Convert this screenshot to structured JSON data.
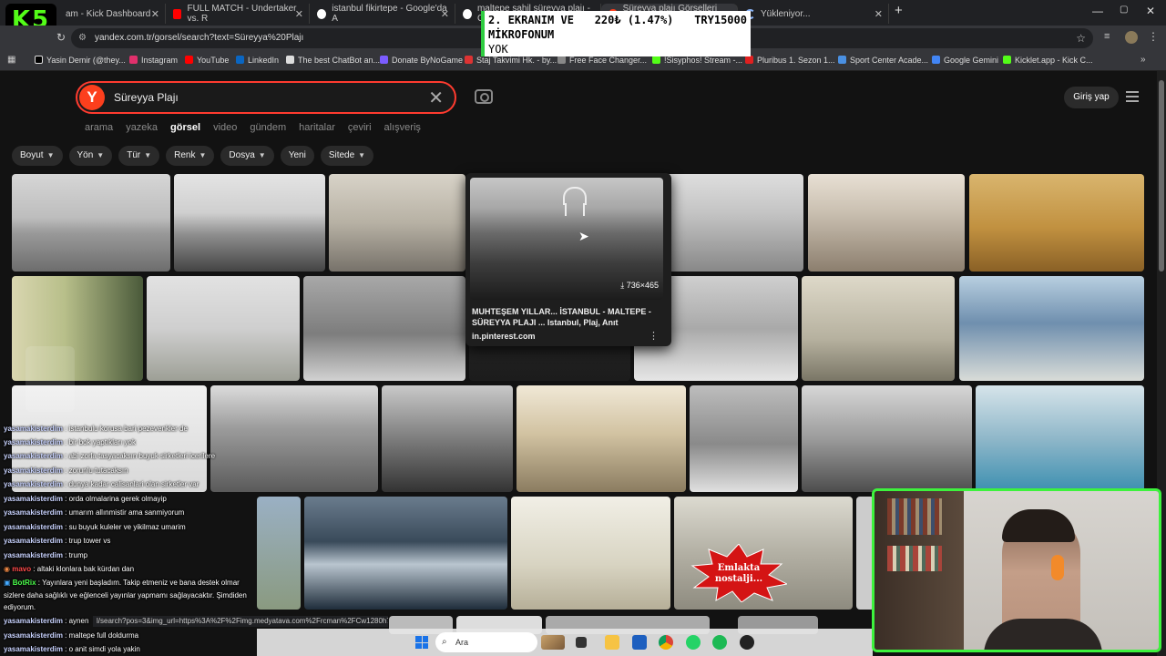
{
  "stream_logo": "K5",
  "tabs": [
    {
      "label": "am - Kick Dashboard"
    },
    {
      "label": "FULL MATCH - Undertaker vs. R"
    },
    {
      "label": "istanbul fikirtepe - Google'da A"
    },
    {
      "label": "maltepe sahil süreyya plajı - Go"
    },
    {
      "label": "Süreyya plajı Görselleri görsel"
    },
    {
      "label": "Yükleniyor..."
    }
  ],
  "window_controls": {
    "minimize": "—",
    "maximize": "▢",
    "close": "✕",
    "new_tab": "+"
  },
  "address_bar": {
    "url": "yandex.com.tr/gorsel/search?text=Süreyya%20Plajı"
  },
  "bookmarks": [
    {
      "label": "Yasin Demir (@they...",
      "color": "#000000"
    },
    {
      "label": "Instagram",
      "color": "#e1306c"
    },
    {
      "label": "YouTube",
      "color": "#ff0000"
    },
    {
      "label": "LinkedIn",
      "color": "#0a66c2"
    },
    {
      "label": "The best ChatBot an...",
      "color": "#dddddd"
    },
    {
      "label": "Donate ByNoGame",
      "color": "#7b5cff"
    },
    {
      "label": "Staj Takvimi Hk. - by...",
      "color": "#d33"
    },
    {
      "label": "Free Face Changer...",
      "color": "#888888"
    },
    {
      "label": "!Sisyphos! Stream -...",
      "color": "#53fc18"
    },
    {
      "label": "Pluribus 1. Sezon 1...",
      "color": "#e02020"
    },
    {
      "label": "Sport Center Acade...",
      "color": "#4a90e2"
    },
    {
      "label": "Google Gemini",
      "color": "#4285f4"
    },
    {
      "label": "Kicklet.app - Kick C...",
      "color": "#53fc18"
    }
  ],
  "overlay": {
    "line1_left": "2. EKRANIM VE",
    "line1_mid": "220₺ (1.47%)",
    "line1_right": "TRY15000",
    "line2": "MİKROFONUM",
    "line3": "YOK"
  },
  "search": {
    "logo": "Y",
    "query": "Süreyya Plajı",
    "clear": "✕"
  },
  "header": {
    "login": "Giriş yap"
  },
  "nav_tabs": [
    "arama",
    "yazeka",
    "görsel",
    "video",
    "gündem",
    "haritalar",
    "çeviri",
    "alışveriş"
  ],
  "nav_active_index": 2,
  "filters": [
    {
      "label": "Boyut",
      "has_dropdown": true
    },
    {
      "label": "Yön",
      "has_dropdown": true
    },
    {
      "label": "Tür",
      "has_dropdown": true
    },
    {
      "label": "Renk",
      "has_dropdown": true
    },
    {
      "label": "Dosya",
      "has_dropdown": true
    },
    {
      "label": "Yeni",
      "has_dropdown": false
    },
    {
      "label": "Sitede",
      "has_dropdown": true
    }
  ],
  "popup": {
    "size": "736×465",
    "title": "MUHTEŞEM YILLAR... İSTANBUL - MALTEPE - SÜREYYA PLAJI ... Istanbul, Plaj, Anıt",
    "source": "in.pinterest.com",
    "more": "⋮"
  },
  "emlak_badge": "Emlakta nostalji...",
  "chat": [
    {
      "user": "yasamakisterdim",
      "text": "istanbulu korusa bari pezevenkler de"
    },
    {
      "user": "yasamakisterdim",
      "text": "bir bok yaptıkları yok"
    },
    {
      "user": "yasamakisterdim",
      "text": "abi zorla tasyacaksın buyuk sirketleri icerilere"
    },
    {
      "user": "yasamakisterdim",
      "text": "zorunlu tutacaksın"
    },
    {
      "user": "yasamakisterdim",
      "text": "dunya kadar calisanlari olan sirketler var"
    },
    {
      "user": "yasamakisterdim",
      "text": "orda olmalarina gerek olmayip"
    },
    {
      "user": "yasamakisterdim",
      "text": "umarım allınmistir ama sanmiyorum"
    },
    {
      "user": "yasamakisterdim",
      "text": "su buyuk kuleler ve yikilmaz umarim"
    },
    {
      "user": "yasamakisterdim",
      "text": "trup tower vs"
    },
    {
      "user": "yasamakisterdim",
      "text": "trump"
    },
    {
      "user": "mavo",
      "text": "altaki klonlara bak kürdan dan"
    },
    {
      "user": "BotRix",
      "text": "Yayınlara yeni başladım. Takip etmeniz ve bana destek olmar"
    },
    {
      "user": "",
      "text": "sizlere daha sağlıklı ve eğlenceli yayınlar yapmamı sağlayacaktır. Şimdiden"
    },
    {
      "user": "",
      "text": "ediyorum."
    },
    {
      "user": "yasamakisterdim",
      "text": "aynen"
    },
    {
      "user": "yasamakisterdim",
      "text": "maltepe full doldurma"
    },
    {
      "user": "yasamakisterdim",
      "text": "o anit simdi yola yakin"
    }
  ],
  "status_url": "l/search?pos=3&img_url=https%3A%2F%2Fimg.medyatava.com%2Frcman%2FCw1280h7...",
  "taskbar": {
    "search_placeholder": "Ara"
  }
}
